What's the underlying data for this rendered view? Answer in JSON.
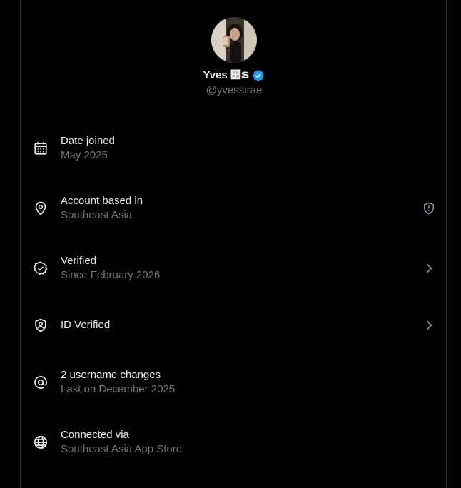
{
  "profile": {
    "display_name": "Yves ໢ຣ",
    "handle": "@yvessirae",
    "verified": true,
    "badge_color": "#1d9bf0"
  },
  "rows": [
    {
      "icon": "calendar-icon",
      "title": "Date joined",
      "subtitle": "May 2025",
      "trailing": null
    },
    {
      "icon": "location-pin-icon",
      "title": "Account based in",
      "subtitle": "Southeast Asia",
      "trailing": "shield-alert-icon"
    },
    {
      "icon": "verified-check-icon",
      "title": "Verified",
      "subtitle": "Since February 2026",
      "trailing": "chevron-right-icon"
    },
    {
      "icon": "id-shield-icon",
      "title": "ID Verified",
      "subtitle": "",
      "trailing": "chevron-right-icon"
    },
    {
      "icon": "at-sign-icon",
      "title": "2 username changes",
      "subtitle": "Last on December 2025",
      "trailing": null
    },
    {
      "icon": "globe-icon",
      "title": "Connected via",
      "subtitle": "Southeast Asia App Store",
      "trailing": null
    }
  ],
  "colors": {
    "background": "#000000",
    "primary_text": "#e7e9ea",
    "secondary_text": "#71767b",
    "border": "#2f3336"
  }
}
